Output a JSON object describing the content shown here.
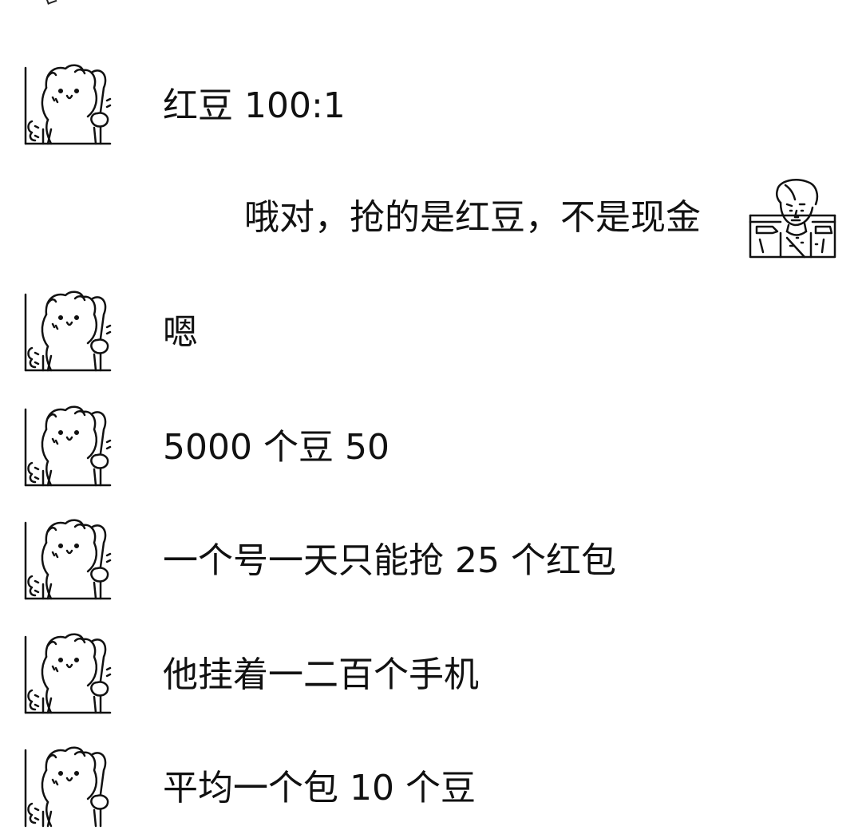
{
  "chat": {
    "messages": [
      {
        "side": "left",
        "avatar_icon": "cat-avatar-icon",
        "text": "红豆 100:1"
      },
      {
        "side": "right",
        "avatar_icon": "man-avatar-icon",
        "text": "哦对，抢的是红豆，不是现金"
      },
      {
        "side": "left",
        "avatar_icon": "cat-avatar-icon",
        "text": "嗯"
      },
      {
        "side": "left",
        "avatar_icon": "cat-avatar-icon",
        "text": "5000 个豆 50"
      },
      {
        "side": "left",
        "avatar_icon": "cat-avatar-icon",
        "text": "一个号一天只能抢 25 个红包"
      },
      {
        "side": "left",
        "avatar_icon": "cat-avatar-icon",
        "text": "他挂着一二百个手机"
      },
      {
        "side": "left",
        "avatar_icon": "cat-avatar-icon",
        "text": "平均一个包 10 个豆"
      }
    ]
  }
}
